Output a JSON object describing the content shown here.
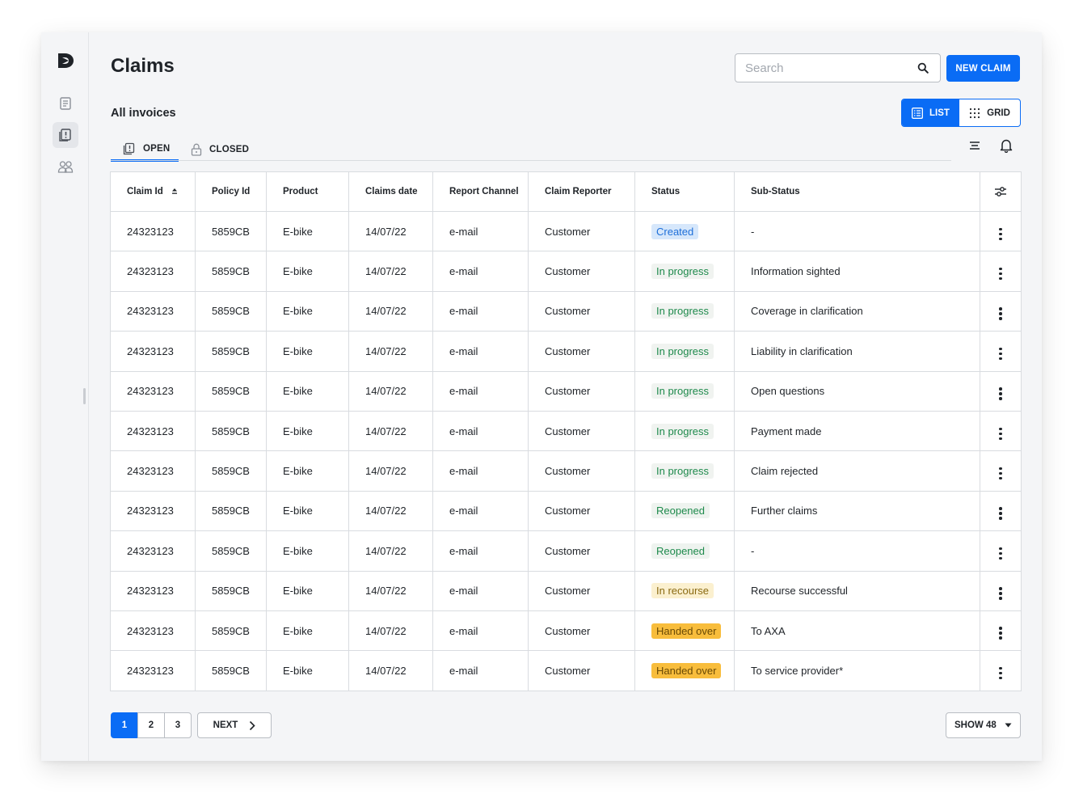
{
  "page": {
    "title": "Claims",
    "section_title": "All invoices"
  },
  "search": {
    "placeholder": "Search"
  },
  "toolbar": {
    "new_claim_label": "NEW CLAIM"
  },
  "view_toggle": {
    "list_label": "LIST",
    "grid_label": "GRID",
    "selected": "list"
  },
  "tabs": [
    {
      "label": "OPEN",
      "active": true
    },
    {
      "label": "CLOSED",
      "active": false
    }
  ],
  "table": {
    "columns": [
      "Claim Id",
      "Policy Id",
      "Product",
      "Claims date",
      "Report Channel",
      "Claim Reporter",
      "Status",
      "Sub-Status"
    ],
    "rows": [
      {
        "claim_id": "24323123",
        "policy_id": "5859CB",
        "product": "E-bike",
        "date": "14/07/22",
        "channel": "e-mail",
        "reporter": "Customer",
        "status": "Created",
        "status_type": "created",
        "sub_status": "-"
      },
      {
        "claim_id": "24323123",
        "policy_id": "5859CB",
        "product": "E-bike",
        "date": "14/07/22",
        "channel": "e-mail",
        "reporter": "Customer",
        "status": "In progress",
        "status_type": "inprogress",
        "sub_status": "Information sighted"
      },
      {
        "claim_id": "24323123",
        "policy_id": "5859CB",
        "product": "E-bike",
        "date": "14/07/22",
        "channel": "e-mail",
        "reporter": "Customer",
        "status": "In progress",
        "status_type": "inprogress",
        "sub_status": "Coverage in clarification"
      },
      {
        "claim_id": "24323123",
        "policy_id": "5859CB",
        "product": "E-bike",
        "date": "14/07/22",
        "channel": "e-mail",
        "reporter": "Customer",
        "status": "In progress",
        "status_type": "inprogress",
        "sub_status": "Liability in clarification"
      },
      {
        "claim_id": "24323123",
        "policy_id": "5859CB",
        "product": "E-bike",
        "date": "14/07/22",
        "channel": "e-mail",
        "reporter": "Customer",
        "status": "In progress",
        "status_type": "inprogress",
        "sub_status": "Open questions"
      },
      {
        "claim_id": "24323123",
        "policy_id": "5859CB",
        "product": "E-bike",
        "date": "14/07/22",
        "channel": "e-mail",
        "reporter": "Customer",
        "status": "In progress",
        "status_type": "inprogress",
        "sub_status": "Payment made"
      },
      {
        "claim_id": "24323123",
        "policy_id": "5859CB",
        "product": "E-bike",
        "date": "14/07/22",
        "channel": "e-mail",
        "reporter": "Customer",
        "status": "In progress",
        "status_type": "inprogress",
        "sub_status": "Claim rejected"
      },
      {
        "claim_id": "24323123",
        "policy_id": "5859CB",
        "product": "E-bike",
        "date": "14/07/22",
        "channel": "e-mail",
        "reporter": "Customer",
        "status": "Reopened",
        "status_type": "reopened",
        "sub_status": "Further claims"
      },
      {
        "claim_id": "24323123",
        "policy_id": "5859CB",
        "product": "E-bike",
        "date": "14/07/22",
        "channel": "e-mail",
        "reporter": "Customer",
        "status": "Reopened",
        "status_type": "reopened",
        "sub_status": "-"
      },
      {
        "claim_id": "24323123",
        "policy_id": "5859CB",
        "product": "E-bike",
        "date": "14/07/22",
        "channel": "e-mail",
        "reporter": "Customer",
        "status": "In recourse",
        "status_type": "recourse",
        "sub_status": "Recourse successful"
      },
      {
        "claim_id": "24323123",
        "policy_id": "5859CB",
        "product": "E-bike",
        "date": "14/07/22",
        "channel": "e-mail",
        "reporter": "Customer",
        "status": "Handed over",
        "status_type": "handed",
        "sub_status": "To AXA"
      },
      {
        "claim_id": "24323123",
        "policy_id": "5859CB",
        "product": "E-bike",
        "date": "14/07/22",
        "channel": "e-mail",
        "reporter": "Customer",
        "status": "Handed over",
        "status_type": "handed",
        "sub_status": "To service provider*"
      }
    ]
  },
  "pagination": {
    "pages": [
      "1",
      "2",
      "3"
    ],
    "current": "1",
    "next_label": "NEXT"
  },
  "show": {
    "label": "SHOW 48"
  },
  "colors": {
    "accent": "#0a6cf5",
    "background": "#f4f5f7",
    "handed_over": "#f8bd3c",
    "created": "#d6e7fb"
  },
  "icons": {
    "sidebar": [
      "logo-icon",
      "document-icon",
      "claims-icon",
      "users-icon"
    ],
    "toolbar": [
      "search-icon",
      "list-icon",
      "grid-icon",
      "filter-icon",
      "bell-icon",
      "settings-icon"
    ]
  }
}
